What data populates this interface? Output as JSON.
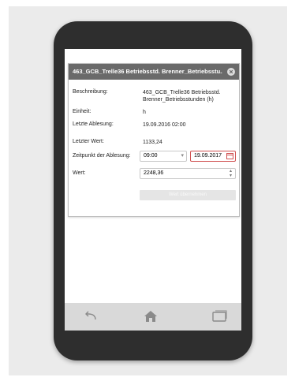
{
  "dialog": {
    "title": "463_GCB_Trelle36 Betriebsstd. Brenner_Betriebsstu...",
    "close_icon": "close-circle-icon"
  },
  "fields": {
    "description_label": "Beschreibung:",
    "description_value_line1": "463_GCB_Trelle36 Betriebsstd.",
    "description_value_line2": "Brenner_Betriebsstunden (h)",
    "unit_label": "Einheit:",
    "unit_value": "h",
    "last_reading_label": "Letzte Ablesung:",
    "last_reading_value": "19.09.2016 02:00",
    "last_value_label": "Letzter Wert:",
    "last_value_value": "1133,24",
    "reading_time_label": "Zeitpunkt der Ablesung:",
    "reading_time_value": "09:00",
    "reading_date_value": "19.09.2017",
    "value_label": "Wert:",
    "value_value": "2248,36"
  },
  "actions": {
    "submit_label": "Wert übernehmen"
  },
  "navbar": {
    "back_icon": "back-icon",
    "home_icon": "home-icon",
    "recents_icon": "recents-icon"
  },
  "colors": {
    "header_bg": "#6a6a6a",
    "date_border": "#d05050",
    "phone_body": "#2e2e2e",
    "navbar_bg": "#d9d9d9"
  }
}
